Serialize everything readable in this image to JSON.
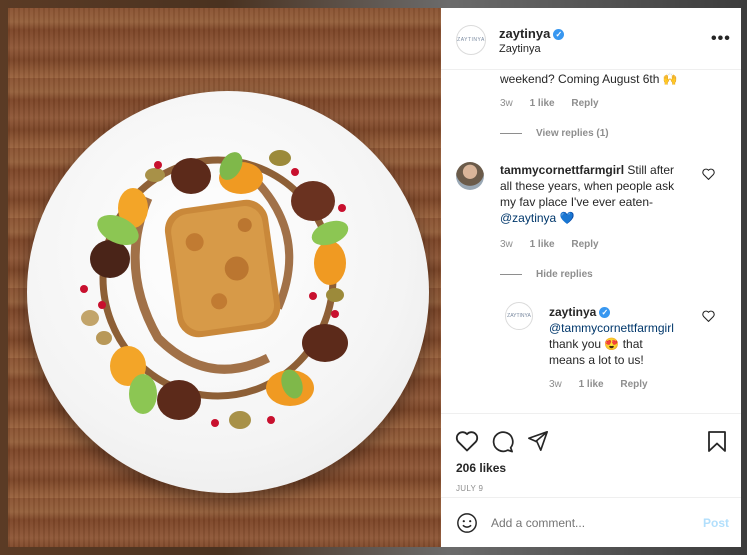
{
  "header": {
    "avatar_text": "ZAYTINYA",
    "username": "zaytinya",
    "subtitle": "Zaytinya",
    "more_label": "•••"
  },
  "comments": [
    {
      "partial_text": "weekend? Coming August 6th 🙌",
      "time": "3w",
      "likes": "1 like",
      "reply": "Reply",
      "replies_toggle": "View replies (1)"
    },
    {
      "username": "tammycornettfarmgirl",
      "text_line1": "Still after",
      "text_line2": "all these years, when people ask",
      "text_line3": "my fav place I've ever eaten-",
      "mention": "@zaytinya",
      "emoji": "💙",
      "time": "3w",
      "likes": "1 like",
      "reply": "Reply",
      "replies_toggle": "Hide replies"
    },
    {
      "username": "zaytinya",
      "avatar_text": "ZAYTINYA",
      "mention": "@tammycornettfarmgirl",
      "text_line1": "thank you",
      "emoji": "😍",
      "text_line1b": "that",
      "text_line2": "means a lot to us!",
      "time": "3w",
      "likes": "1 like",
      "reply": "Reply"
    }
  ],
  "actions": {
    "likes": "206 likes",
    "date": "JULY 9"
  },
  "add_comment": {
    "placeholder": "Add a comment...",
    "post_label": "Post"
  },
  "colors": {
    "verified": "#3897f0",
    "link": "#00376b",
    "post_disabled": "#b2dffc",
    "muted": "#8e8e8e"
  }
}
